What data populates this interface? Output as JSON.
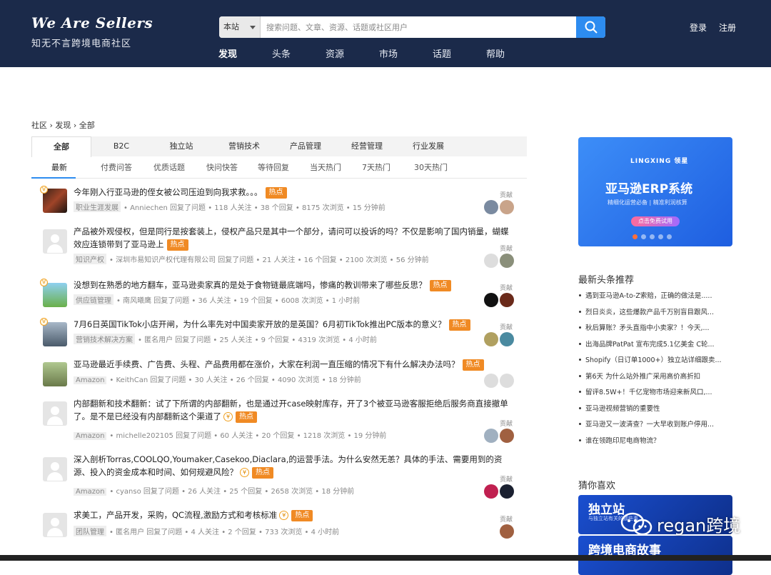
{
  "header": {
    "logo_title": "We Are Sellers",
    "logo_subtitle": "知无不言跨境电商社区",
    "search_scope": "本站",
    "search_placeholder": "搜索问题、文章、资源、话题或社区用户",
    "login": "登录",
    "register": "注册",
    "nav": [
      "发现",
      "头条",
      "资源",
      "市场",
      "话题",
      "帮助"
    ]
  },
  "breadcrumb": "社区 › 发现 › 全部",
  "tabs": [
    "全部",
    "B2C",
    "独立站",
    "营销技术",
    "产品管理",
    "经营管理",
    "行业发展"
  ],
  "subtabs": [
    "最新",
    "付费问答",
    "优质话题",
    "快问快答",
    "等待回复",
    "当天热门",
    "7天热门",
    "30天热门"
  ],
  "hot_label": "热点",
  "contrib_label": "贡献",
  "questions": [
    {
      "title": "今年刚入行亚马逊的侄女被公司压迫到向我求救。。。",
      "tag": "职业生涯发展",
      "meta": "• Anniechen 回复了问题 • 118 人关注 • 38 个回复 • 8175 次浏览 • 15 分钟前"
    },
    {
      "title": "产品被外观侵权，但是同行是按套装上，侵权产品只是其中一个部分，请问可以投诉的吗？不仅是影响了国内销量，蝴蝶效应连锁带到了亚马逊上",
      "tag": "知识产权",
      "meta": "• 深圳市易知识产权代理有限公司 回复了问题 • 21 人关注 • 16 个回复 • 2100 次浏览 • 56 分钟前"
    },
    {
      "title": "没想到在熟悉的地方翻车，亚马逊卖家真的是处于食物链最底端吗，惨痛的教训带来了哪些反思？",
      "tag": "供应链管理",
      "meta": "• 南风曦鹰 回复了问题 • 36 人关注 • 19 个回复 • 6008 次浏览 • 1 小时前"
    },
    {
      "title": "7月6日英国TikTok小店开闸，为什么率先对中国卖家开放的是英国？6月初TikTok推出PC版本的意义？",
      "tag": "营销技术解决方案",
      "meta": "• 匿名用户 回复了问题 • 25 人关注 • 9 个回复 • 4319 次浏览 • 4 小时前"
    },
    {
      "title": "亚马逊最近手续费、广告费、头程、产品费用都在涨价，大家在利润一直压缩的情况下有什么解决办法吗？",
      "tag": "Amazon",
      "meta": "• KeithCan 回复了问题 • 30 人关注 • 26 个回复 • 4090 次浏览 • 18 分钟前"
    },
    {
      "title": "内部翻新和技术翻新：试了下所谓的内部翻新，也是通过开case映射库存，开了3个被亚马逊客服拒绝后服务商直接撤单了。是不是已经没有内部翻新这个渠道了",
      "tag": "Amazon",
      "meta": "• michelle202105 回复了问题 • 60 人关注 • 20 个回复 • 1218 次浏览 • 19 分钟前"
    },
    {
      "title": "深入剖析Torras,COOLQO,Youmaker,Casekoo,Diaclara,的运营手法。为什么安然无恙？具体的手法、需要用到的资源、投入的资金成本和时间、如何规避风险？",
      "tag": "Amazon",
      "meta": "• cyanso 回复了问题 • 26 人关注 • 25 个回复 • 2658 次浏览 • 18 分钟前"
    },
    {
      "title": "求美工，产品开发，采购，QC流程,激励方式和考核标准",
      "tag": "团队管理",
      "meta": "• 匿名用户 回复了问题 • 4 人关注 • 2 个回复 • 733 次浏览 • 4 小时前"
    }
  ],
  "banner": {
    "brand": "LINGXING 领星",
    "headline": "亚马逊ERP系统",
    "tagline": "精细化运营必备 | 精准利润核算",
    "cta": "点击免费试用"
  },
  "sidebar": {
    "news_title": "最新头条推荐",
    "news": [
      "遇到亚马逊A-to-Z索赔，正确的做法是.....",
      "烈日炎炎，这些爆款产品千万别盲目跟风...",
      "秋后算账？矛头直指中小卖家？！今天,...",
      "出海品牌PatPat 宣布完成5.1亿美金 C轮...",
      "Shopify（日订单1000+）独立站详细跟卖...",
      "第6天 为什么站外推广采用高价高折扣",
      "留评8.5W+！千亿宠物市场迎来新风口,...",
      "亚马逊视频营销的重要性",
      "亚马逊又一波清查？一大早收到账户停用...",
      "谁在领跑印尼电商物流？"
    ],
    "guess_title": "猜你喜欢",
    "guess_cards": [
      {
        "title": "独立站",
        "sub": "与独立站有关的那些事"
      },
      {
        "title": "跨境电商故事",
        "sub": ""
      }
    ]
  },
  "watermark": "regan跨境"
}
